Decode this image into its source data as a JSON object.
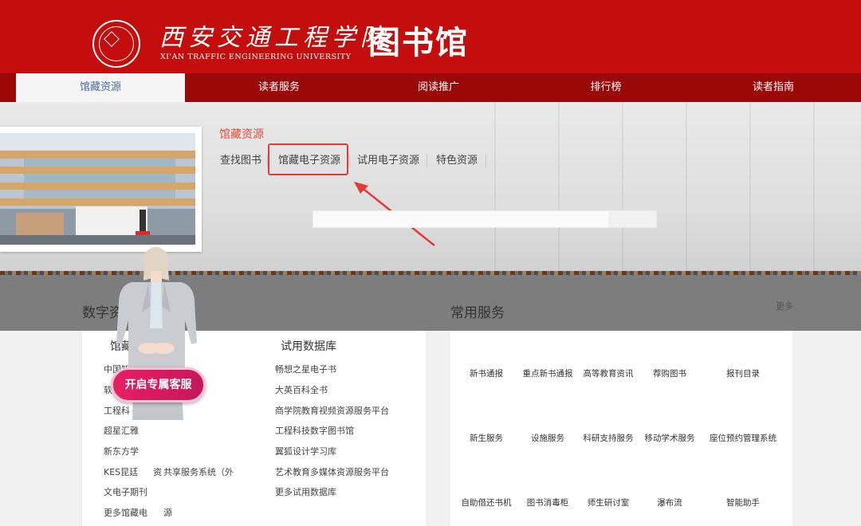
{
  "header": {
    "university_cn": "西安交通工程学院",
    "university_en": "XI'AN TRAFFIC ENGINEERING UNIVERSITY",
    "library_title": "图书馆",
    "brand_color": "#c40d0d"
  },
  "nav": {
    "items": [
      {
        "label": "馆藏资源",
        "active": true
      },
      {
        "label": "读者服务"
      },
      {
        "label": "阅读推广"
      },
      {
        "label": "排行榜"
      },
      {
        "label": "读者指南"
      }
    ]
  },
  "banner": {
    "section_title": "馆藏资源",
    "sub_items": [
      "查找图书",
      "馆藏电子资源",
      "试用电子资源",
      "特色资源"
    ],
    "highlighted_item": "馆藏电子资源",
    "highlight_color": "#e53935"
  },
  "digital_resources": {
    "title": "数字资",
    "col1_title": "馆藏",
    "col1_items": [
      "中国知",
      "软",
      "工程科",
      "超星汇雅",
      "新东方学",
      "KES昆廷",
      "资",
      "共享服务系统（外",
      "文电子期刊",
      "更多馆藏电",
      "源"
    ],
    "col2_title": "试用数据库",
    "col2_items": [
      "畅想之星电子书",
      "大英百科全书",
      "商学院教育视频资源服务平台",
      "工程科技数字图书馆",
      "翼狐设计学习库",
      "艺术教育多媒体资源服务平台",
      "更多试用数据库"
    ]
  },
  "common_services": {
    "title": "常用服务",
    "more": "更多",
    "rows": [
      [
        "新书通报",
        "重点新书通报",
        "高等教育资讯",
        "荐购图书",
        "报刊目录"
      ],
      [
        "新生服务",
        "设施服务",
        "科研支持服务",
        "移动学术服务",
        "座位预约管理系统"
      ],
      [
        "自助借还书机",
        "图书消毒柜",
        "师生研讨室",
        "瀑布流",
        "智能助手"
      ]
    ]
  },
  "assistant": {
    "button_label": "开启专属客服",
    "button_color": "#e91e63"
  }
}
